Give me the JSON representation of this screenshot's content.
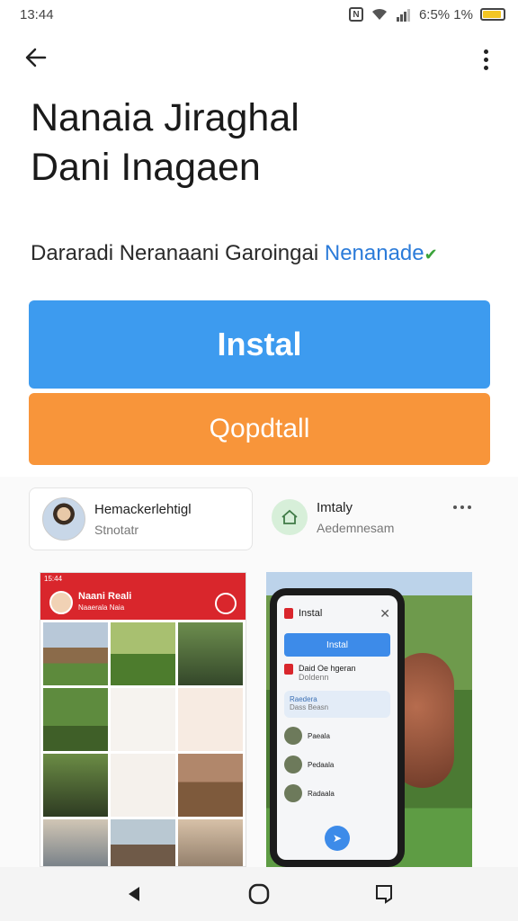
{
  "status_bar": {
    "time": "13:44",
    "nfc": "N",
    "battery_text": "6:5% 1%"
  },
  "app": {
    "title_line1": "Nanaia Jiraghal",
    "title_line2": "Dani Inagaen",
    "developer_prefix": "Dararadi Neranaani Garoingai",
    "developer_link": "Nenanade"
  },
  "buttons": {
    "install": "Instal",
    "secondary": "Qopdtall"
  },
  "cards": {
    "profile": {
      "title": "Hemackerlehtigl",
      "subtitle": "Stnotatr"
    },
    "info": {
      "title": "Imtaly",
      "subtitle": "Aedemnesam"
    }
  },
  "screenshot1": {
    "time": "15:44",
    "title": "Naani Reali",
    "subtitle": "Naaerala Naia"
  },
  "screenshot2": {
    "header": "Instal",
    "install": "Instal",
    "item1": "Daid Oe hgeran",
    "item1_sub": "Doldenn",
    "highlight_title": "Raedera",
    "highlight_sub": "Dass Beasn",
    "list": [
      "Paeala",
      "Pedaala",
      "Radaala"
    ]
  },
  "colors": {
    "install": "#3d9bef",
    "secondary": "#f8953a",
    "accent_red": "#d9262c",
    "link": "#2b7bd9"
  }
}
